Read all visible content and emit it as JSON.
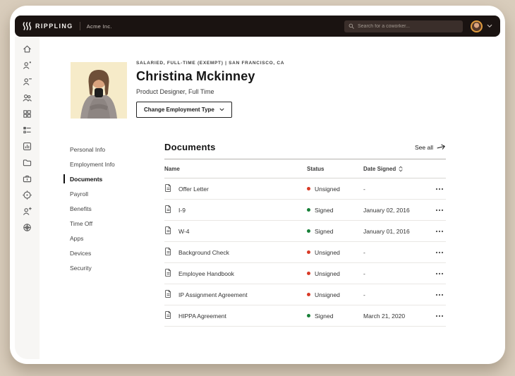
{
  "colors": {
    "page_bg": "#d9cdbc",
    "window_bg": "#ffffff",
    "topbar_bg": "#1a1311",
    "rail_bg": "#f7f6f4",
    "avatar_ring": "#e09b3d",
    "status_signed": "#188038",
    "status_unsigned": "#d93a26",
    "photo_bg": "#f6ebc9"
  },
  "topbar": {
    "brand": "RIPPLING",
    "company": "Acme Inc.",
    "search_placeholder": "Search for a coworker..."
  },
  "icon_rail": {
    "items": [
      "home",
      "person-dot",
      "person-minus",
      "people",
      "grid",
      "checklist",
      "analytics",
      "folder",
      "briefcase",
      "target",
      "person-plus",
      "globe"
    ]
  },
  "profile": {
    "eyebrow": "SALARIED, FULL-TIME (EXEMPT) | SAN FRANCISCO, CA",
    "name": "Christina Mckinney",
    "subtitle": "Product Designer, Full Time",
    "change_button": "Change Employment Type"
  },
  "nav": {
    "items": [
      {
        "label": "Personal Info",
        "active": false
      },
      {
        "label": "Employment Info",
        "active": false
      },
      {
        "label": "Documents",
        "active": true
      },
      {
        "label": "Payroll",
        "active": false
      },
      {
        "label": "Benefits",
        "active": false
      },
      {
        "label": "Time Off",
        "active": false
      },
      {
        "label": "Apps",
        "active": false
      },
      {
        "label": "Devices",
        "active": false
      },
      {
        "label": "Security",
        "active": false
      }
    ]
  },
  "documents": {
    "title": "Documents",
    "see_all": "See all",
    "columns": {
      "name": "Name",
      "status": "Status",
      "date": "Date Signed"
    },
    "rows": [
      {
        "name": "Offer Letter",
        "status": "Unsigned",
        "date": "-"
      },
      {
        "name": "I-9",
        "status": "Signed",
        "date": "January 02, 2016"
      },
      {
        "name": "W-4",
        "status": "Signed",
        "date": "January 01, 2016"
      },
      {
        "name": "Background Check",
        "status": "Unsigned",
        "date": "-"
      },
      {
        "name": "Employee Handbook",
        "status": "Unsigned",
        "date": "-"
      },
      {
        "name": "IP Assignment Agreement",
        "status": "Unsigned",
        "date": "-"
      },
      {
        "name": "HIPPA Agreement",
        "status": "Signed",
        "date": "March 21, 2020"
      }
    ]
  }
}
